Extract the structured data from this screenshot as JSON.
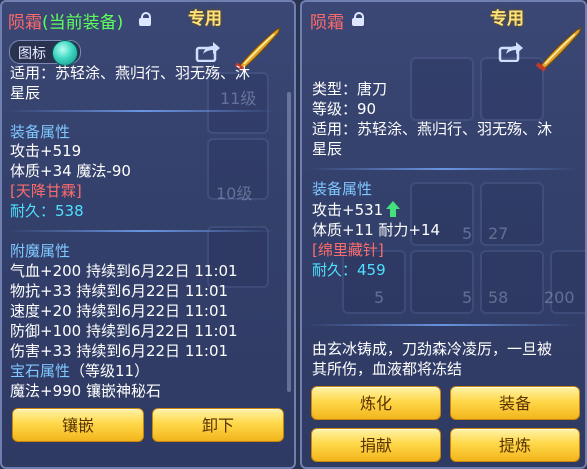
{
  "left": {
    "title_name": "陨霜",
    "title_current": "(当前装备)",
    "badge": "专用",
    "toggle_label": "图标",
    "lines": {
      "applies": "适用：苏轻涂、燕归行、羽无殇、沐",
      "applies2": "星辰",
      "equip_header": "装备属性",
      "attack": "攻击+519",
      "stats": "体质+34 魔法-90",
      "special": "[天降甘霖]",
      "durability_label": "耐久：",
      "durability": "538",
      "enchant_header": "附魔属性",
      "e1": "气血+200 持续到6月22日 11:01",
      "e2": "物抗+33 持续到6月22日 11:01",
      "e3": "速度+20 持续到6月22日 11:01",
      "e4": "防御+100 持续到6月22日 11:01",
      "e5": "伤害+33 持续到6月22日 11:01",
      "gem_header": "宝石属性",
      "gem_level": "（等级11）",
      "gem_value": "魔法+990 镶嵌神秘石"
    },
    "buttons": {
      "inlay": "镶嵌",
      "unequip": "卸下"
    },
    "ghosts": {
      "lvl1": "11级",
      "lvl2": "10级"
    }
  },
  "right": {
    "title_name": "陨霜",
    "badge": "专用",
    "lines": {
      "type": "类型：唐刀",
      "level": "等级：90",
      "applies": "适用：苏轻涂、燕归行、羽无殇、沐",
      "applies2": "星辰",
      "equip_header": "装备属性",
      "attack": "攻击+531",
      "stats": "体质+11 耐力+14",
      "special": "[绵里藏针]",
      "durability_label": "耐久：",
      "durability": "459",
      "desc1": "由玄冰铸成，刀劲森冷凌厉，一旦被",
      "desc2": "其所伤，血液都将冻结"
    },
    "buttons": {
      "refine": "炼化",
      "equip": "装备",
      "donate": "捐献",
      "extract": "提炼"
    },
    "ghosts": {
      "n27": "27",
      "n5a": "5",
      "n58": "58",
      "n200": "200",
      "n5b": "5",
      "n5c": "5"
    }
  }
}
